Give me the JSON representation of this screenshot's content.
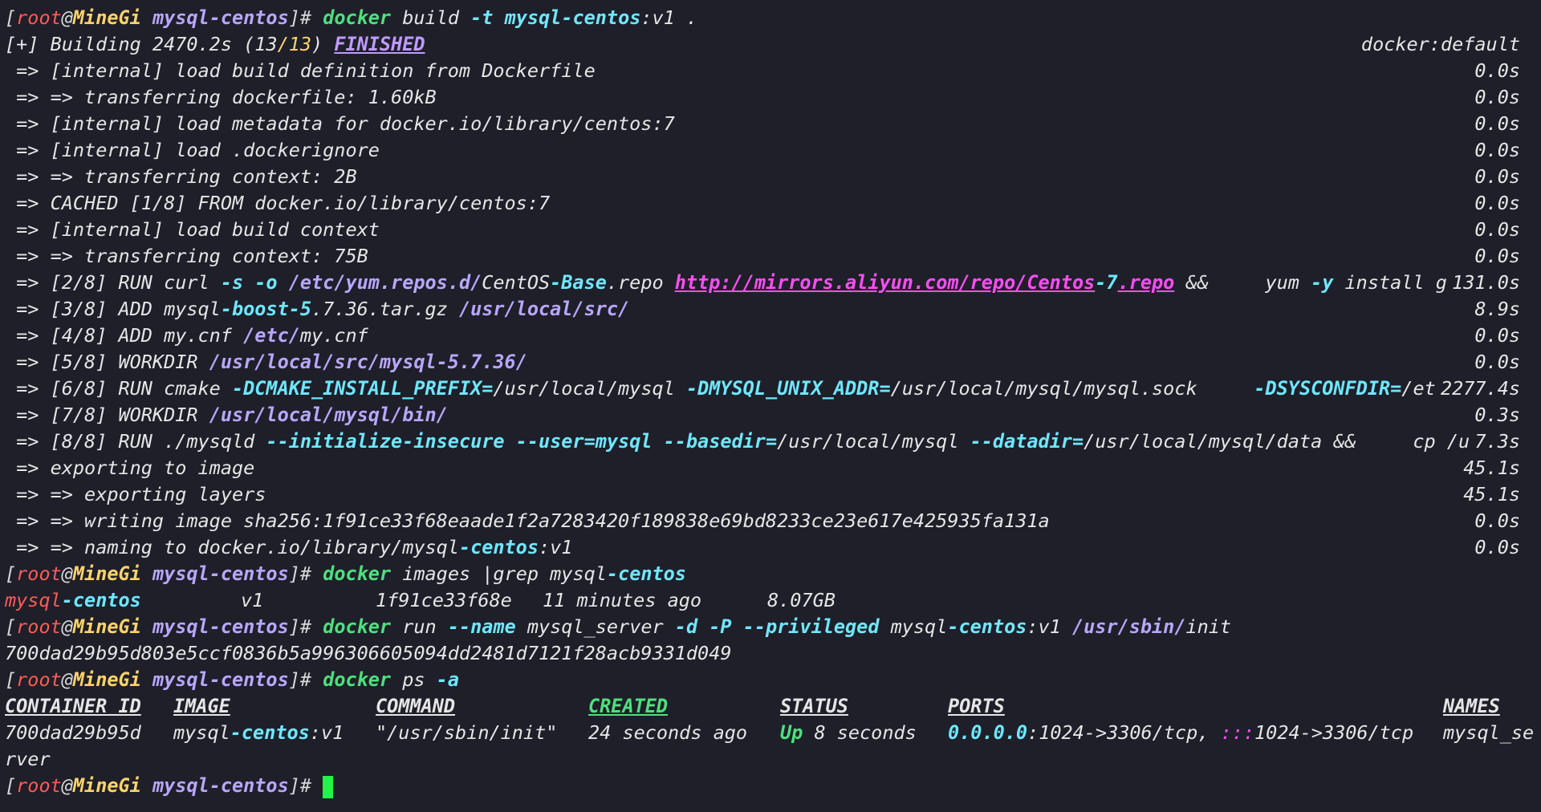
{
  "prompt": {
    "user": "root",
    "at": "@",
    "host": "MineGi",
    "dir": "mysql-centos",
    "suffix": "]#"
  },
  "cmd_build": {
    "docker": "docker",
    "a": "build",
    "flag": "-t",
    "image": "mysql-centos",
    "tag": ":v1 ."
  },
  "build_status": {
    "prefix": "[+] Building 2470.2s (13",
    "slash": "/",
    "count": "13",
    "close": ")",
    "finished": "FINISHED",
    "right": "docker:default"
  },
  "steps": [
    {
      "text": "=> [internal] load build definition from Dockerfile",
      "time": "0.0s"
    },
    {
      "text": "=> => transferring dockerfile: 1.60kB",
      "time": "0.0s"
    },
    {
      "text": "=> [internal] load metadata for docker.io/library/centos:7",
      "time": "0.0s"
    },
    {
      "text": "=> [internal] load .dockerignore",
      "time": "0.0s"
    },
    {
      "text": "=> => transferring context: 2B",
      "time": "0.0s"
    },
    {
      "text": "=> CACHED [1/8] FROM docker.io/library/centos:7",
      "time": "0.0s"
    },
    {
      "text": "=> [internal] load build context",
      "time": "0.0s"
    },
    {
      "text": "=> => transferring context: 75B",
      "time": "0.0s"
    }
  ],
  "step2": {
    "a": "=> [2/8] RUN curl ",
    "f1": "-s -o",
    "p1": " /etc/yum.repos.d/",
    "b": "CentOS",
    "c": "-Base",
    ".repo": ".repo ",
    "link1": "http://mirrors.aliyun.com/repo/Centos",
    "dash": "-7",
    "link2": ".repo",
    "d": " &&     yum ",
    "y": "-y",
    "e": " install g",
    "time": "131.0s"
  },
  "step3": {
    "a": "=> [3/8] ADD mysql",
    "b": "-boost-5",
    "c": ".7.36.tar.gz ",
    "path": "/usr/local/src/",
    "time": "8.9s"
  },
  "step4": {
    "a": "=> [4/8] ADD my.cnf ",
    "path": "/etc/",
    "b": "my.cnf",
    "time": "0.0s"
  },
  "step5": {
    "a": "=> [5/8] WORKDIR ",
    "path": "/usr/local/src/mysql-5.7.36/",
    "time": "0.0s"
  },
  "step6": {
    "a": "=> [6/8] RUN cmake ",
    "f1": "-DCMAKE_INSTALL_PREFIX=",
    "b": "/usr/local/mysql ",
    "f2": "-DMYSQL_UNIX_ADDR=",
    "c": "/usr/local/mysql/mysql.sock     ",
    "f3": "-DSYSCONFDIR=",
    "d": "/et",
    "time": "2277.4s"
  },
  "step7": {
    "a": "=> [7/8] WORKDIR ",
    "path": "/usr/local/mysql/bin/",
    "time": "0.3s"
  },
  "step8": {
    "a": "=> [8/8] RUN ./mysqld ",
    "f1": "--initialize-insecure --user=mysql --basedir=",
    "b": "/usr/local/mysql ",
    "f2": "--datadir=",
    "c": "/usr/local/mysql/data &&     cp /u",
    "time": "7.3s"
  },
  "export": [
    {
      "text": "=> exporting to image",
      "time": "45.1s"
    },
    {
      "text": "=> => exporting layers",
      "time": "45.1s"
    },
    {
      "text": "=> => writing image sha256:1f91ce33f68eaade1f2a7283420f189838e69bd8233ce23e617e425935fa131a",
      "time": "0.0s"
    },
    {
      "text": "=> => naming to docker.io/library/mysql",
      "b": "-centos",
      "c": ":v1",
      "time": "0.0s"
    }
  ],
  "cmd_images": {
    "a": " images |grep mysql",
    "b": "-centos"
  },
  "images_row": {
    "repo": "mysql",
    "repo2": "-centos",
    "tag": "v1",
    "id": "1f91ce33f68e",
    "created": "11 minutes ago",
    "size": "8.07GB"
  },
  "cmd_run": {
    "a": " run ",
    "f1": "--name",
    "b": " mysql_server ",
    "f2": "-d -P --privileged",
    "c": " mysql",
    "d": "-centos",
    ":v1": ":v1 ",
    "path": "/usr/sbin/",
    "e": "init"
  },
  "container_hash": "700dad29b95d803e5ccf0836b5a996306605094dd2481d7121f28acb9331d049",
  "cmd_ps": {
    "a": " ps ",
    "f": "-a"
  },
  "ps_header": {
    "id": "CONTAINER ID",
    "image": "IMAGE",
    "command": "COMMAND",
    "created": "CREATED",
    "status": "STATUS",
    "ports": "PORTS",
    "names": "NAMES"
  },
  "ps_row": {
    "id": "700dad29b95d",
    "image": "mysql",
    "image2": "-centos",
    ":v1": ":v1",
    "command": "\"/usr/sbin/init\"",
    "created": "24 seconds ago",
    "up": "Up",
    "status": " 8 seconds",
    "ip": "0.0.0.0",
    ":p1": ":1024->3306/tcp, ",
    "ip6": ":::",
    ":p2": "1024->3306/tcp",
    "names": "mysql_se",
    "names2": "rver"
  }
}
